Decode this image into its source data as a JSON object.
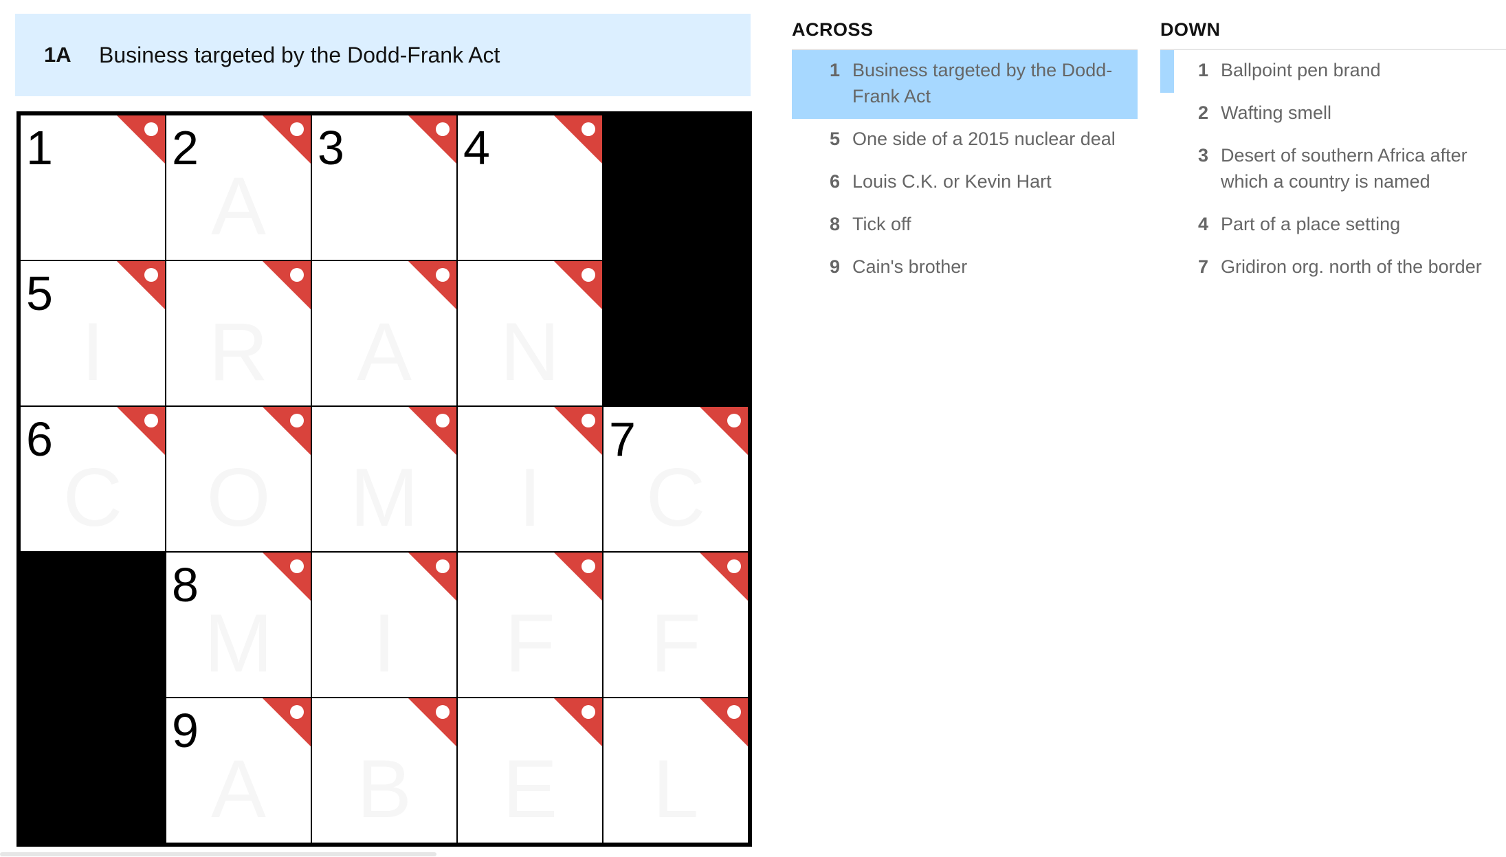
{
  "clue_bar": {
    "number": "1A",
    "text": "Business targeted by the Dodd-Frank Act"
  },
  "grid": {
    "cells": [
      {
        "num": "1",
        "letter": "",
        "block": false,
        "flag": true
      },
      {
        "num": "2",
        "letter": "A",
        "block": false,
        "flag": true
      },
      {
        "num": "3",
        "letter": "",
        "block": false,
        "flag": true
      },
      {
        "num": "4",
        "letter": "",
        "block": false,
        "flag": true
      },
      {
        "num": "",
        "letter": "",
        "block": true,
        "flag": false
      },
      {
        "num": "5",
        "letter": "I",
        "block": false,
        "flag": true
      },
      {
        "num": "",
        "letter": "R",
        "block": false,
        "flag": true
      },
      {
        "num": "",
        "letter": "A",
        "block": false,
        "flag": true
      },
      {
        "num": "",
        "letter": "N",
        "block": false,
        "flag": true
      },
      {
        "num": "",
        "letter": "",
        "block": true,
        "flag": false
      },
      {
        "num": "6",
        "letter": "C",
        "block": false,
        "flag": true
      },
      {
        "num": "",
        "letter": "O",
        "block": false,
        "flag": true
      },
      {
        "num": "",
        "letter": "M",
        "block": false,
        "flag": true
      },
      {
        "num": "",
        "letter": "I",
        "block": false,
        "flag": true
      },
      {
        "num": "7",
        "letter": "C",
        "block": false,
        "flag": true
      },
      {
        "num": "",
        "letter": "",
        "block": true,
        "flag": false
      },
      {
        "num": "8",
        "letter": "M",
        "block": false,
        "flag": true
      },
      {
        "num": "",
        "letter": "I",
        "block": false,
        "flag": true
      },
      {
        "num": "",
        "letter": "F",
        "block": false,
        "flag": true
      },
      {
        "num": "",
        "letter": "F",
        "block": false,
        "flag": true
      },
      {
        "num": "",
        "letter": "",
        "block": true,
        "flag": false
      },
      {
        "num": "9",
        "letter": "A",
        "block": false,
        "flag": true
      },
      {
        "num": "",
        "letter": "B",
        "block": false,
        "flag": true
      },
      {
        "num": "",
        "letter": "E",
        "block": false,
        "flag": true
      },
      {
        "num": "",
        "letter": "L",
        "block": false,
        "flag": true
      }
    ]
  },
  "across": {
    "title": "ACROSS",
    "clues": [
      {
        "num": "1",
        "text": "Business targeted by the Dodd-Frank Act",
        "state": "selected"
      },
      {
        "num": "5",
        "text": "One side of a 2015 nuclear deal",
        "state": ""
      },
      {
        "num": "6",
        "text": "Louis C.K. or Kevin Hart",
        "state": ""
      },
      {
        "num": "8",
        "text": "Tick off",
        "state": ""
      },
      {
        "num": "9",
        "text": "Cain's brother",
        "state": ""
      }
    ]
  },
  "down": {
    "title": "DOWN",
    "clues": [
      {
        "num": "1",
        "text": "Ballpoint pen brand",
        "state": "related"
      },
      {
        "num": "2",
        "text": "Wafting smell",
        "state": ""
      },
      {
        "num": "3",
        "text": "Desert of southern Africa after which a country is named",
        "state": ""
      },
      {
        "num": "4",
        "text": "Part of a place setting",
        "state": ""
      },
      {
        "num": "7",
        "text": "Gridiron org. north of the border",
        "state": ""
      }
    ]
  }
}
